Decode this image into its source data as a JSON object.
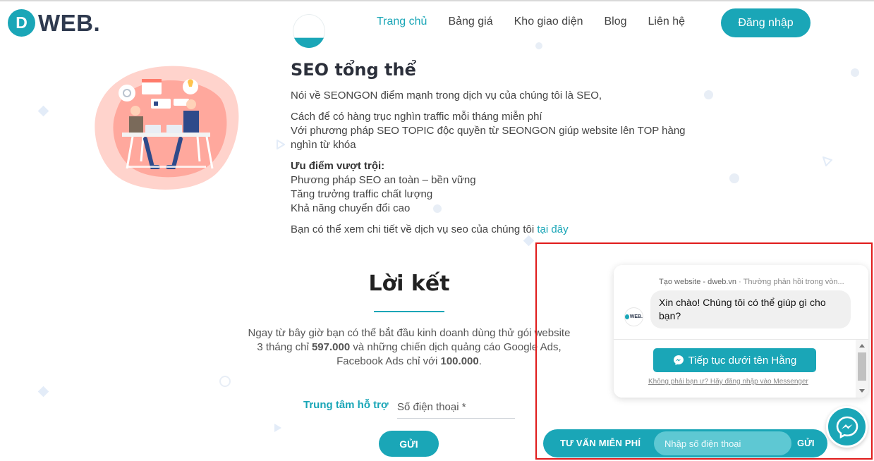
{
  "header": {
    "logo_letter": "D",
    "logo_text": "WEB.",
    "nav": [
      {
        "label": "Trang chủ"
      },
      {
        "label": "Bảng giá"
      },
      {
        "label": "Kho giao diện"
      },
      {
        "label": "Blog"
      },
      {
        "label": "Liên hệ"
      }
    ],
    "login_label": "Đăng nhập"
  },
  "seo": {
    "title": "SEO tổng thể",
    "intro": "Nói về SEONGON điểm mạnh trong dịch vụ của chúng tôi là SEO,",
    "line1": "Cách để có hàng trục nghìn traffic mỗi tháng miễn phí",
    "line2": "Với phương pháp SEO TOPIC độc quyền từ SEONGON giúp website lên TOP hàng nghìn từ khóa",
    "advantages_title": "Ưu điểm vượt trội:",
    "advantages": [
      "Phương pháp SEO an toàn – bền vững",
      "Tăng trưởng traffic chất lượng",
      "Khả năng chuyển đổi cao"
    ],
    "detail_text": "Bạn có thể xem chi tiết về dịch vụ seo của chúng tôi ",
    "detail_link": "tại đây"
  },
  "conclusion": {
    "title": "Lời kết",
    "text_1": "Ngay từ bây giờ bạn có thể bắt đầu kinh doanh dùng thử gói website 3 tháng chỉ ",
    "price_1": "597.000",
    "text_2": " và những chiến dịch quảng cáo Google Ads, Facebook Ads chỉ với ",
    "price_2": "100.000",
    "text_3": "."
  },
  "support": {
    "label": "Trung tâm hỗ trợ",
    "phone_placeholder": "Số điện thoại *",
    "send_label": "GỬI"
  },
  "chat": {
    "header_name": "Tạo website - dweb.vn",
    "header_status": " · Thường phản hồi trong vòn...",
    "avatar_text": "WEB.",
    "message": "Xin chào! Chúng tôi có thể giúp gì cho bạn?",
    "continue_label": "Tiếp tục dưới tên Hằng",
    "not_you_label": "Không phải bạn ư? Hãy đăng nhập vào Messenger"
  },
  "consult_bar": {
    "label": "TƯ VẤN MIỄN PHÍ",
    "input_placeholder": "Nhập số điện thoại",
    "send_label": "GỬI"
  },
  "colors": {
    "accent": "#1aa6b7",
    "highlight": "#e01b1b"
  }
}
